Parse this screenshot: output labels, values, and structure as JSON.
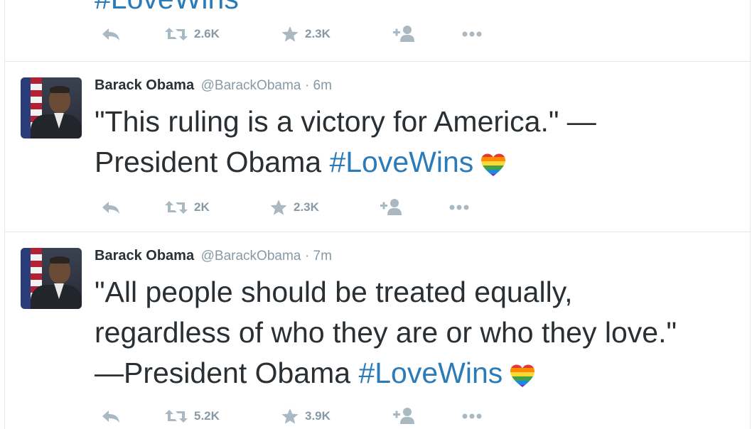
{
  "previous_tweet": {
    "text_cut": "#LoveWins",
    "retweets": "2.6K",
    "favorites": "2.3K"
  },
  "tweets": [
    {
      "fullname": "Barack Obama",
      "handle": "@BarackObama",
      "time": "· 6m",
      "text_plain": "\"This ruling is a victory for America.\" —President Obama ",
      "hashtag": "#LoveWins",
      "retweets": "2K",
      "favorites": "2.3K"
    },
    {
      "fullname": "Barack Obama",
      "handle": "@BarackObama",
      "time": "· 7m",
      "text_plain": "\"All people should be treated equally, regardless of who they are or who they love.\" —President Obama ",
      "hashtag": "#LoveWins",
      "retweets": "5.2K",
      "favorites": "3.9K"
    }
  ],
  "icons": {
    "reply": "reply-icon",
    "retweet": "retweet-icon",
    "favorite": "star-icon",
    "follow": "follow-icon",
    "more": "more-icon",
    "emoji": "rainbow-heart-icon"
  },
  "colors": {
    "text": "#292f33",
    "muted": "#8899a6",
    "hashtag": "#2b7bb9",
    "border": "#e1e8ed"
  }
}
